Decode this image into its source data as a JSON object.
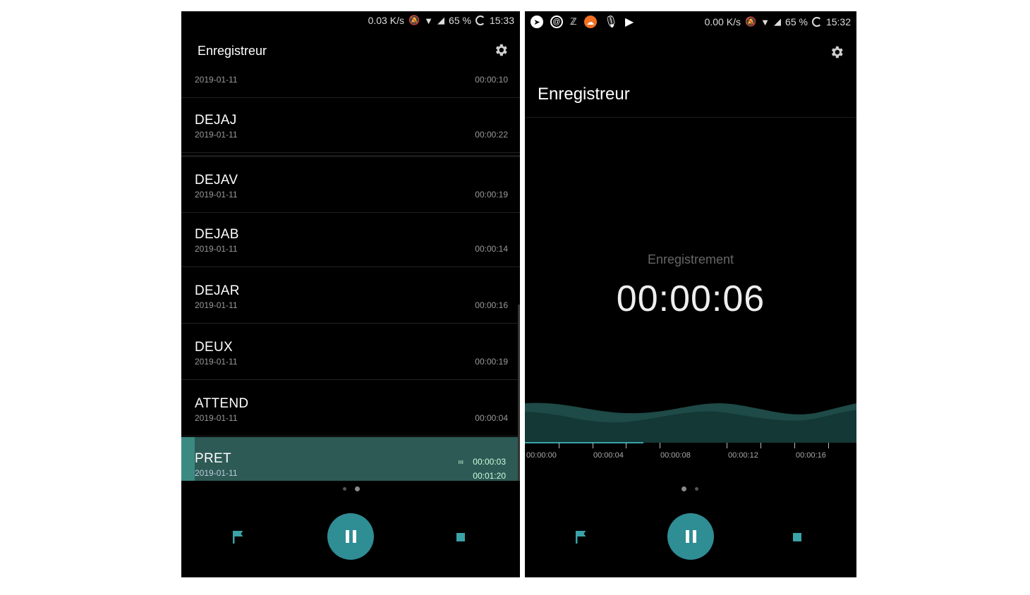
{
  "left_screen": {
    "status_bar": {
      "speed": "0.03 K/s",
      "battery": "65 %",
      "time": "15:33"
    },
    "title": "Enregistreur",
    "partial_top_row": {
      "date": "2019-01-11",
      "duration": "00:00:10"
    },
    "recordings": [
      {
        "name": "DEJAJ",
        "date": "2019-01-11",
        "duration": "00:00:22"
      },
      {
        "name": "DEJAV",
        "date": "2019-01-11",
        "duration": "00:00:19"
      },
      {
        "name": "DEJAB",
        "date": "2019-01-11",
        "duration": "00:00:14"
      },
      {
        "name": "DEJAR",
        "date": "2019-01-11",
        "duration": "00:00:16"
      },
      {
        "name": "DEUX",
        "date": "2019-01-11",
        "duration": "00:00:19"
      },
      {
        "name": "ATTEND",
        "date": "2019-01-11",
        "duration": "00:00:04"
      }
    ],
    "playing": {
      "name": "PRET",
      "date": "2019-01-11",
      "current": "00:00:03",
      "total": "00:01:20",
      "indicator": "ııı"
    }
  },
  "right_screen": {
    "status_bar": {
      "speed": "0.00 K/s",
      "battery": "65 %",
      "time": "15:32"
    },
    "title": "Enregistreur",
    "status_label": "Enregistrement",
    "timer": "00:00:06",
    "timeline": [
      "00:00:00",
      "00:00:04",
      "00:00:08",
      "00:00:12",
      "00:00:16"
    ]
  },
  "icons": {
    "settings": "gear-icon",
    "flag": "flag-icon",
    "pause": "pause-icon",
    "stop": "stop-icon",
    "wifi": "wifi-icon",
    "signal": "signal-icon",
    "mute": "bell-off-icon",
    "mic": "mic-icon"
  },
  "colors": {
    "accent": "#2f8d94",
    "playing_row": "#2d5a55",
    "wave_light": "#1f4d4a",
    "wave_dark": "#153a37"
  }
}
